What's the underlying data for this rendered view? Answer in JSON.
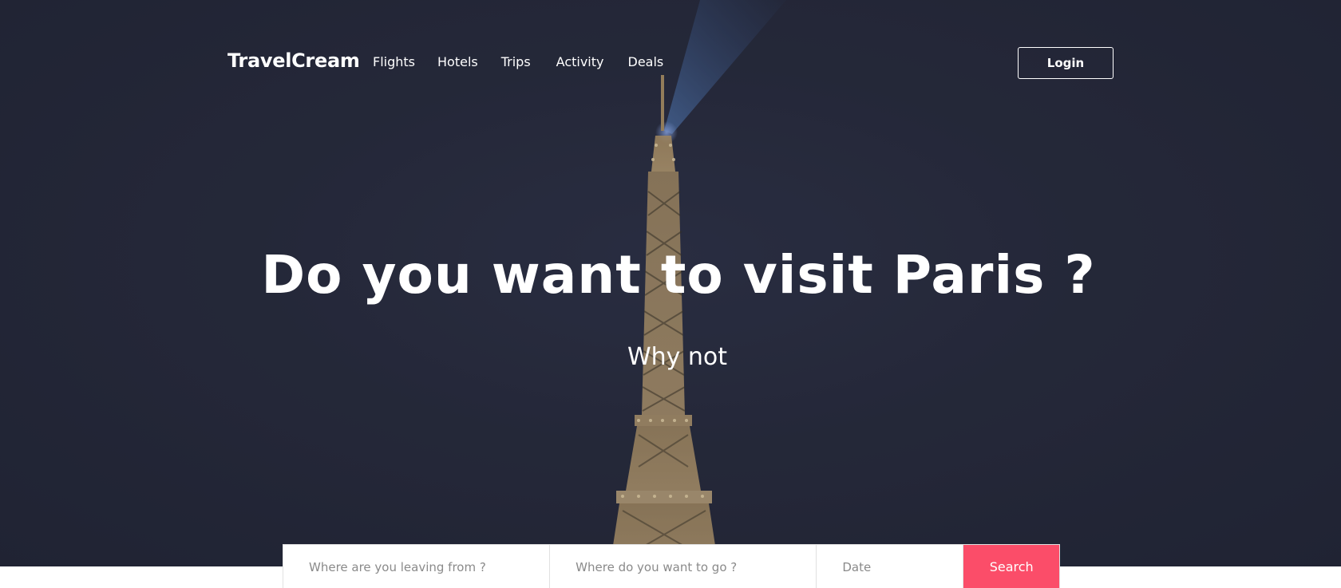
{
  "brand": {
    "name": "TravelCream"
  },
  "nav": {
    "items": [
      {
        "label": "Flights"
      },
      {
        "label": "Hotels"
      },
      {
        "label": "Trips"
      },
      {
        "label": "Activity"
      },
      {
        "label": "Deals"
      }
    ],
    "login_label": "Login"
  },
  "hero": {
    "title": "Do you want to visit Paris ?",
    "subtitle": "Why not",
    "image_icon": "eiffel-tower-icon"
  },
  "search": {
    "from_placeholder": "Where are you leaving from ?",
    "to_placeholder": "Where do you want to go ?",
    "date_placeholder": "Date",
    "button_label": "Search"
  },
  "colors": {
    "hero_background": "#252839",
    "accent": "#fb4d69",
    "text_light": "#ffffff",
    "tower_light": "#d9b57a"
  }
}
